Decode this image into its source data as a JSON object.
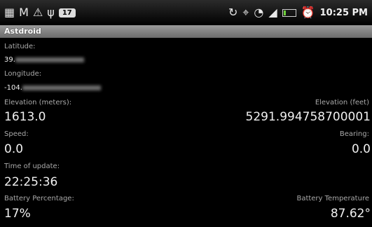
{
  "status_bar": {
    "left_icons": [
      "app-icon",
      "gmail-icon",
      "warning-icon",
      "usb-icon",
      "notification-count-icon"
    ],
    "notification_badge": "17",
    "right_icons": [
      "sync-icon",
      "gps-icon",
      "wifi-icon",
      "signal-icon",
      "battery-icon",
      "alarm-icon"
    ],
    "time": "10:25 PM"
  },
  "app": {
    "title": "Astdroid"
  },
  "fields": {
    "latitude_label": "Latitude:",
    "latitude_value": "39.",
    "longitude_label": "Longitude:",
    "longitude_value": "-104.",
    "elevation_m_label": "Elevation (meters):",
    "elevation_m_value": "1613.0",
    "elevation_ft_label": "Elevation (feet)",
    "elevation_ft_value": "5291.994758700001",
    "speed_label": "Speed:",
    "speed_value": "0.0",
    "bearing_label": "Bearing:",
    "bearing_value": "0.0",
    "time_label": "Time of update:",
    "time_value": "22:25:36",
    "battery_pct_label": "Battery Percentage:",
    "battery_pct_value": "17%",
    "battery_temp_label": "Battery Temperature",
    "battery_temp_value": "87.62°"
  }
}
